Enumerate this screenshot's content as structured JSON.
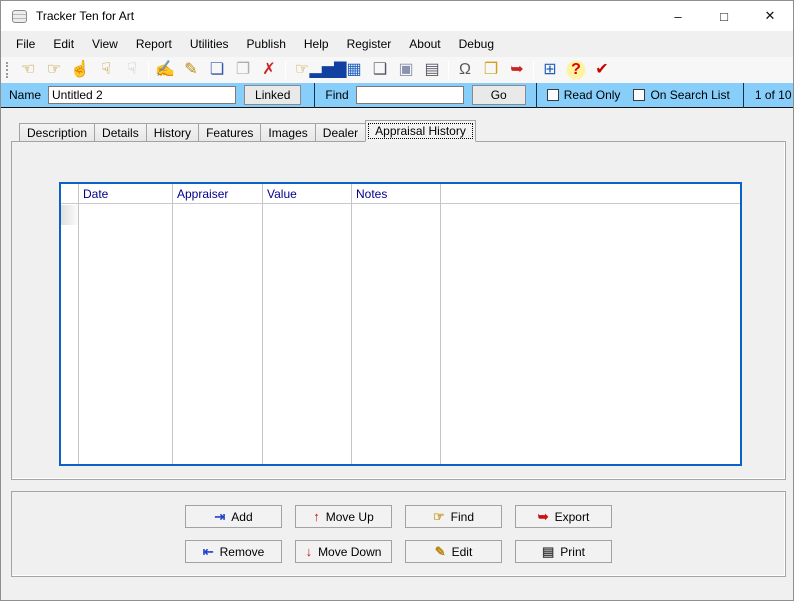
{
  "window": {
    "title": "Tracker Ten for Art",
    "controls": {
      "minimize": "–",
      "maximize": "□",
      "close": "✕"
    }
  },
  "menu": {
    "items": [
      "File",
      "Edit",
      "View",
      "Report",
      "Utilities",
      "Publish",
      "Help",
      "Register",
      "About",
      "Debug"
    ]
  },
  "toolbar": {
    "groups": [
      [
        {
          "name": "nav-first-record-icon",
          "glyph": "☜",
          "color": "#b8860b"
        },
        {
          "name": "nav-next-record-icon",
          "glyph": "☞",
          "color": "#b8860b"
        },
        {
          "name": "nav-up-record-icon",
          "glyph": "☝",
          "color": "#b8860b"
        },
        {
          "name": "nav-last-record-icon",
          "glyph": "☟",
          "color": "#b8860b"
        },
        {
          "name": "nav-ghost-hand-icon",
          "glyph": "☟",
          "color": "#bfbfbf"
        }
      ],
      [
        {
          "name": "new-record-icon",
          "glyph": "✍",
          "color": "#b8860b"
        },
        {
          "name": "edit-record-icon",
          "glyph": "✎",
          "color": "#b8860b"
        },
        {
          "name": "post-record-icon",
          "glyph": "❏",
          "color": "#3355aa"
        },
        {
          "name": "copy-record-disabled-icon",
          "glyph": "❐",
          "color": "#b0b0b0"
        },
        {
          "name": "delete-record-icon",
          "glyph": "✗",
          "color": "#cc2222"
        }
      ],
      [
        {
          "name": "browse-records-icon",
          "glyph": "☞",
          "color": "#c89a2a"
        },
        {
          "name": "report-chart-icon",
          "glyph": "▂▅▇",
          "color": "#1040a0"
        },
        {
          "name": "data-table-icon",
          "glyph": "▦",
          "color": "#2060c0"
        },
        {
          "name": "copy-pages-icon",
          "glyph": "❑",
          "color": "#555566"
        },
        {
          "name": "media-viewer-icon",
          "glyph": "▣",
          "color": "#8a93ad"
        },
        {
          "name": "print-toolbar-icon",
          "glyph": "▤",
          "color": "#555566"
        }
      ],
      [
        {
          "name": "lock-icon",
          "glyph": "Ω",
          "color": "#5a5a5a"
        },
        {
          "name": "open-folder-icon",
          "glyph": "❒",
          "color": "#d4a017"
        },
        {
          "name": "export-save-icon",
          "glyph": "➥",
          "color": "#cc2222"
        }
      ],
      [
        {
          "name": "calculator-icon",
          "glyph": "⊞",
          "color": "#2060c0"
        },
        {
          "name": "help-icon",
          "glyph": "?",
          "color": "#dd0000",
          "halo": true
        },
        {
          "name": "spellcheck-icon",
          "glyph": "✔",
          "color": "#cc0000"
        }
      ]
    ]
  },
  "quickbar": {
    "bar_color": "#87CEFA",
    "name_label": "Name",
    "name_value": "Untitled 2",
    "linked_button": "Linked",
    "find_label": "Find",
    "find_value": "",
    "go_button": "Go",
    "read_only_label": "Read Only",
    "on_search_list_label": "On Search List",
    "record_counter": "1 of 10"
  },
  "tabs": {
    "items": [
      {
        "label": "Description",
        "active": false
      },
      {
        "label": "Details",
        "active": false
      },
      {
        "label": "History",
        "active": false
      },
      {
        "label": "Features",
        "active": false
      },
      {
        "label": "Images",
        "active": false
      },
      {
        "label": "Dealer",
        "active": false
      },
      {
        "label": "Appraisal History",
        "active": true
      }
    ]
  },
  "grid": {
    "columns": [
      "Date",
      "Appraiser",
      "Value",
      "Notes"
    ],
    "rows": [],
    "header_text_color": "#00008B",
    "border_color": "#0a62c8"
  },
  "actions": {
    "buttons": [
      {
        "label": "Add",
        "icon": "add-icon",
        "glyph": "⇥",
        "color": "#2244cc"
      },
      {
        "label": "Move Up",
        "icon": "move-up-icon",
        "glyph": "↑",
        "color": "#cc1111"
      },
      {
        "label": "Find",
        "icon": "find-icon",
        "glyph": "☞",
        "color": "#c89a2a"
      },
      {
        "label": "Export",
        "icon": "export-icon",
        "glyph": "➥",
        "color": "#cc1111"
      },
      {
        "label": "Remove",
        "icon": "remove-icon",
        "glyph": "⇤",
        "color": "#2244cc"
      },
      {
        "label": "Move Down",
        "icon": "move-down-icon",
        "glyph": "↓",
        "color": "#cc1111"
      },
      {
        "label": "Edit",
        "icon": "edit-icon",
        "glyph": "✎",
        "color": "#b8860b"
      },
      {
        "label": "Print",
        "icon": "print-icon",
        "glyph": "▤",
        "color": "#444444"
      }
    ]
  }
}
